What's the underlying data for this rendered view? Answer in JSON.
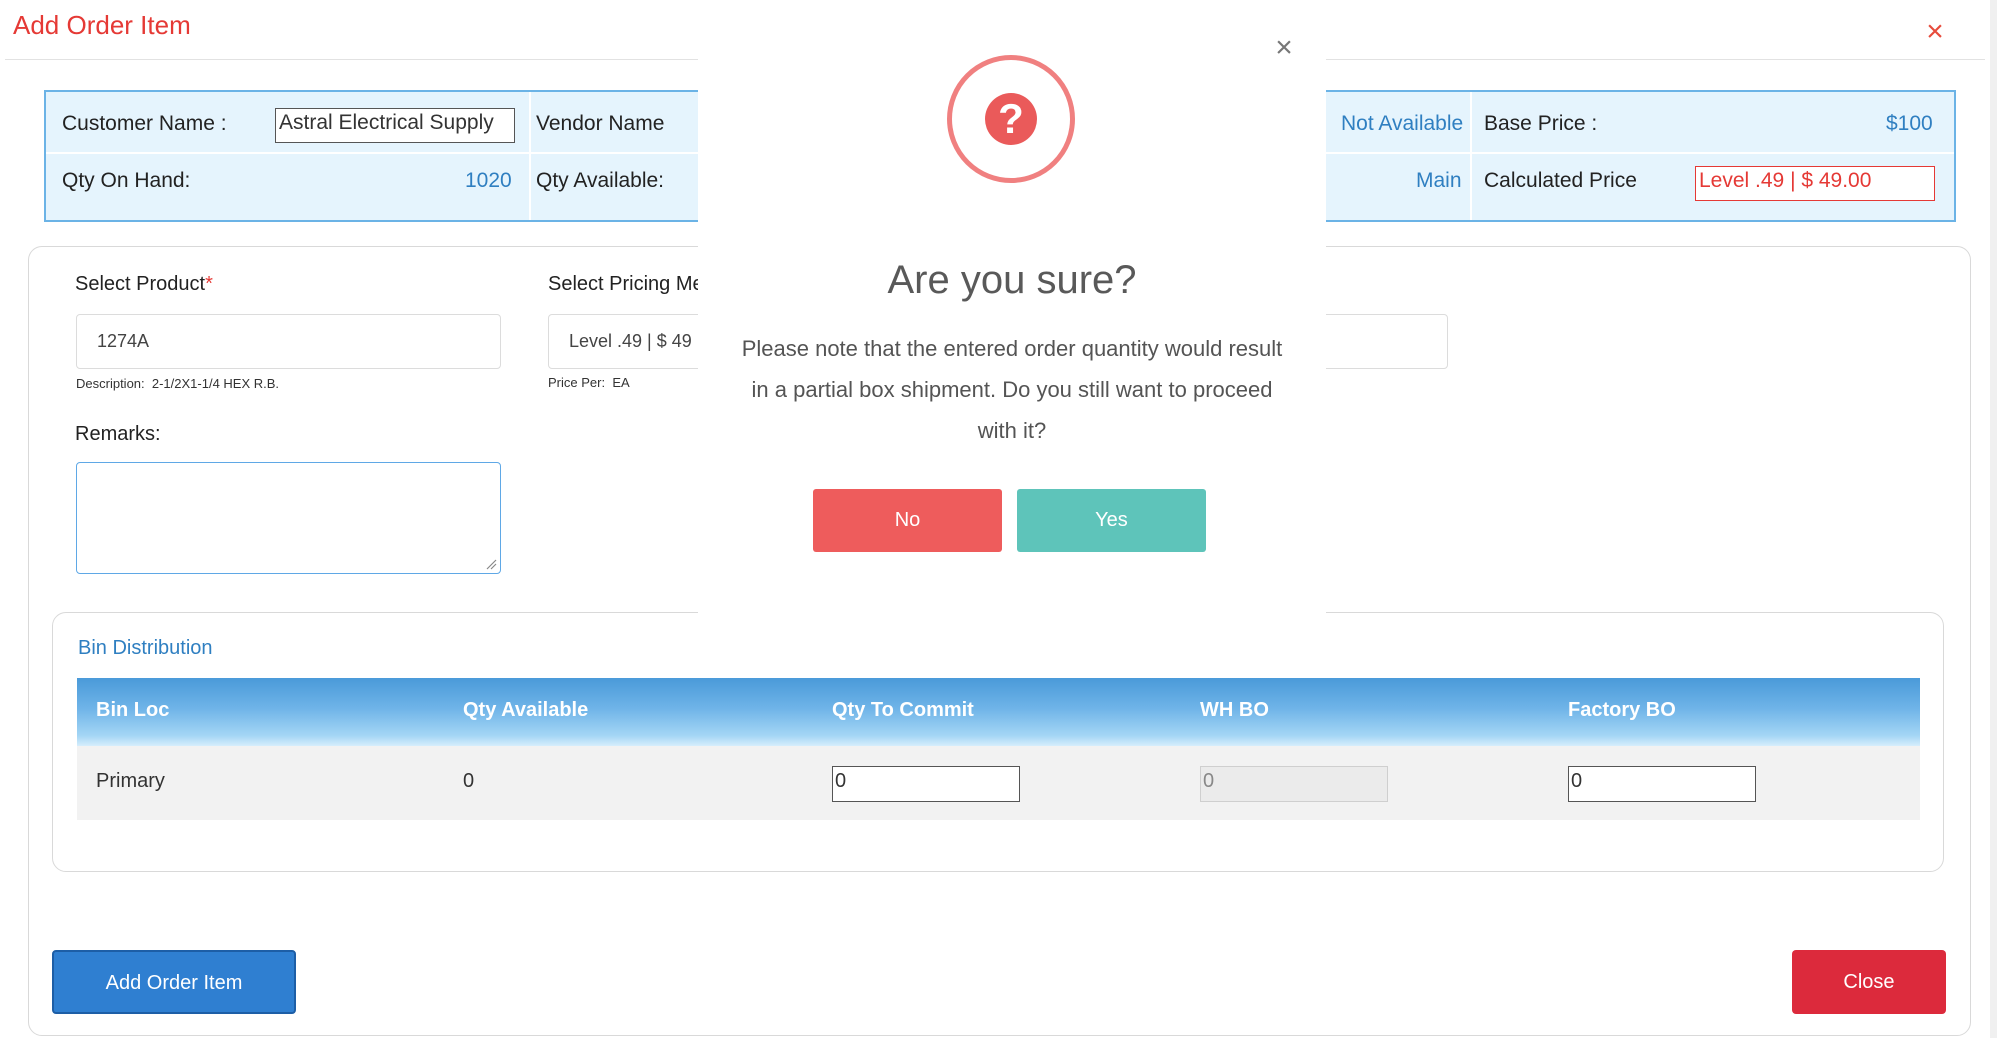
{
  "header": {
    "title": "Add Order Item",
    "close_icon": "×"
  },
  "info": {
    "customer_label": "Customer Name :",
    "customer_value": "Astral Electrical Supply",
    "vendor_label": "Vendor Name",
    "vendor_value": "Not Available",
    "base_price_label": "Base Price :",
    "base_price_value": "$100",
    "qty_on_hand_label": "Qty On Hand:",
    "qty_on_hand_value": "1020",
    "qty_available_label": "Qty Available:",
    "warehouse_value": "Main",
    "calc_price_label": "Calculated Price",
    "calc_price_value": "Level .49 | $ 49.00"
  },
  "form": {
    "select_product_label": "Select Product",
    "required_mark": "*",
    "product_value": "1274A",
    "description_label": "Description:",
    "description_value": "2-1/2X1-1/4 HEX R.B.",
    "pricing_label": "Select Pricing Me",
    "pricing_value": "Level .49 | $ 49",
    "price_per_label": "Price Per:",
    "price_per_value": "EA",
    "remarks_label": "Remarks:",
    "remarks_value": ""
  },
  "bin": {
    "title": "Bin Distribution",
    "headers": [
      "Bin Loc",
      "Qty Available",
      "Qty To Commit",
      "WH BO",
      "Factory BO"
    ],
    "rows": [
      {
        "bin_loc": "Primary",
        "qty_available": "0",
        "qty_to_commit": "0",
        "wh_bo": "0",
        "factory_bo": "0"
      }
    ]
  },
  "buttons": {
    "add": "Add Order Item",
    "close": "Close"
  },
  "modal": {
    "close_icon": "×",
    "icon_glyph": "?",
    "title": "Are you sure?",
    "message": "Please note that the entered order quantity would result in a partial box shipment. Do you still want to proceed with it?",
    "no": "No",
    "yes": "Yes"
  },
  "colors": {
    "title_red": "#e53935",
    "link_blue": "#2f7fc1",
    "add_button": "#2f7fd1",
    "close_button": "#dc2a3c",
    "no_button": "#ee5c5c",
    "yes_button": "#5ec4ba",
    "warning_icon": "#ea5a5a"
  },
  "icons": {
    "modal_icon": "question-circle-icon",
    "dismiss": "close-icon"
  }
}
